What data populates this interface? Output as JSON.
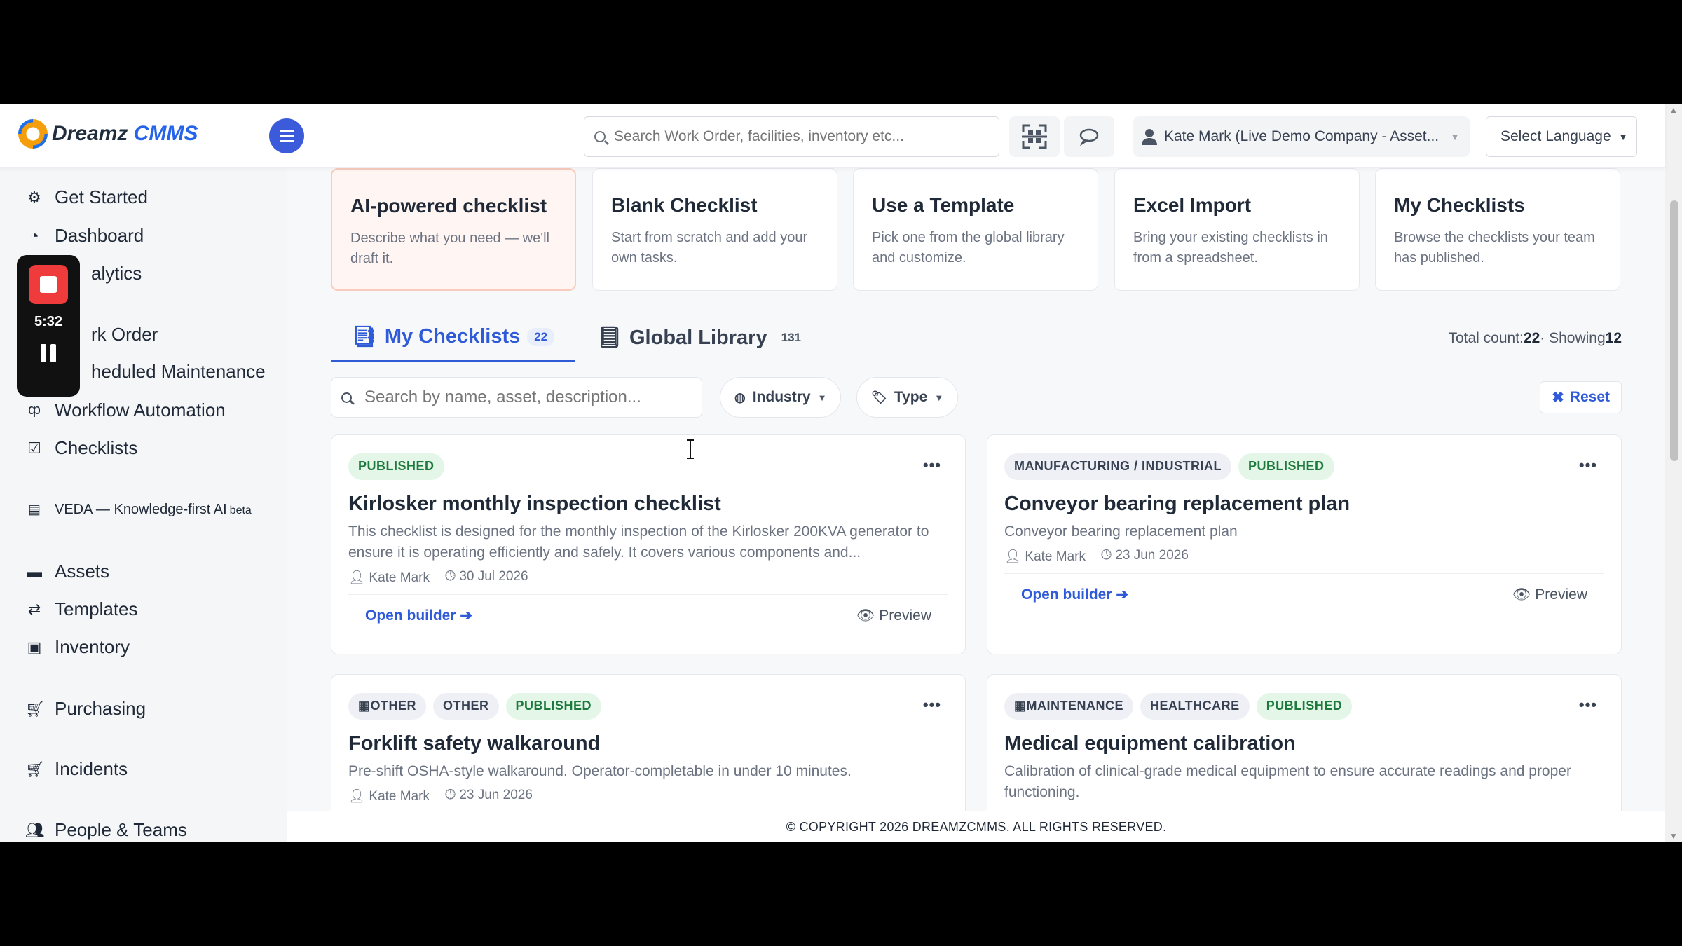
{
  "topbar": {
    "logo_text_1": "Dreamz",
    "logo_text_2": "CMMS",
    "search_placeholder": "Search Work Order, facilities, inventory etc...",
    "user_label": "Kate Mark (Live Demo Company - Asset...",
    "language": "Select Language"
  },
  "sidebar": {
    "items": [
      {
        "label": "Get Started",
        "icon": "gears-icon"
      },
      {
        "label": "Dashboard",
        "icon": "dashboard-icon"
      },
      {
        "label": "alytics",
        "icon": "analytics-icon"
      },
      {
        "label": "rk Order",
        "icon": "work-order-icon"
      },
      {
        "label": "heduled Maintenance",
        "icon": "calendar-icon"
      },
      {
        "label": "Workflow Automation",
        "icon": "workflow-icon"
      },
      {
        "label": "Checklists",
        "icon": "checkbox-icon"
      },
      {
        "label": "VEDA — Knowledge-first AI",
        "badge": "beta",
        "icon": "document-icon"
      },
      {
        "label": "Assets",
        "icon": "assets-icon"
      },
      {
        "label": "Templates",
        "icon": "shuffle-icon"
      },
      {
        "label": "Inventory",
        "icon": "inventory-icon"
      },
      {
        "label": "Purchasing",
        "icon": "cart-icon"
      },
      {
        "label": "Incidents",
        "icon": "cart-icon"
      },
      {
        "label": "People & Teams",
        "icon": "people-icon"
      }
    ]
  },
  "recorder": {
    "time": "5:32"
  },
  "options": [
    {
      "title": "AI-powered checklist",
      "desc": "Describe what you need — we'll draft it."
    },
    {
      "title": "Blank Checklist",
      "desc": "Start from scratch and add your own tasks."
    },
    {
      "title": "Use a Template",
      "desc": "Pick one from the global library and customize."
    },
    {
      "title": "Excel Import",
      "desc": "Bring your existing checklists in from a spreadsheet."
    },
    {
      "title": "My Checklists",
      "desc": "Browse the checklists your team has published."
    }
  ],
  "tabs": [
    {
      "label": "My Checklists",
      "count": "22"
    },
    {
      "label": "Global Library",
      "count": "131"
    }
  ],
  "total": {
    "prefix": "Total count:",
    "count": "22",
    "sep": "· Showing",
    "showing": "12"
  },
  "filters": {
    "search_placeholder": "Search by name, asset, description...",
    "industry": "Industry",
    "type": "Type",
    "reset": "Reset"
  },
  "cards": [
    {
      "badges": [
        "PUBLISHED"
      ],
      "title": "Kirlosker monthly inspection checklist",
      "desc": "This checklist is designed for the monthly inspection of the Kirlosker 200KVA generator to ensure it is operating efficiently and safely. It covers various components and...",
      "author": "Kate Mark",
      "date": "30 Jul 2026",
      "open": "Open builder",
      "preview": "Preview"
    },
    {
      "badges": [
        "MANUFACTURING / INDUSTRIAL",
        "PUBLISHED"
      ],
      "title": "Conveyor bearing replacement plan",
      "desc": "Conveyor bearing replacement plan",
      "author": "Kate Mark",
      "date": "23 Jun 2026",
      "open": "Open builder",
      "preview": "Preview"
    },
    {
      "badges": [
        "OTHER",
        "OTHER",
        "PUBLISHED"
      ],
      "title": "Forklift safety walkaround",
      "desc": "Pre-shift OSHA-style walkaround. Operator-completable in under 10 minutes.",
      "author": "Kate Mark",
      "date": "23 Jun 2026"
    },
    {
      "badges": [
        "MAINTENANCE",
        "HEALTHCARE",
        "PUBLISHED"
      ],
      "title": "Medical equipment calibration",
      "desc": "Calibration of clinical-grade medical equipment to ensure accurate readings and proper functioning."
    }
  ],
  "copyright": "© COPYRIGHT 2026 DREAMZCMMS. ALL RIGHTS RESERVED."
}
